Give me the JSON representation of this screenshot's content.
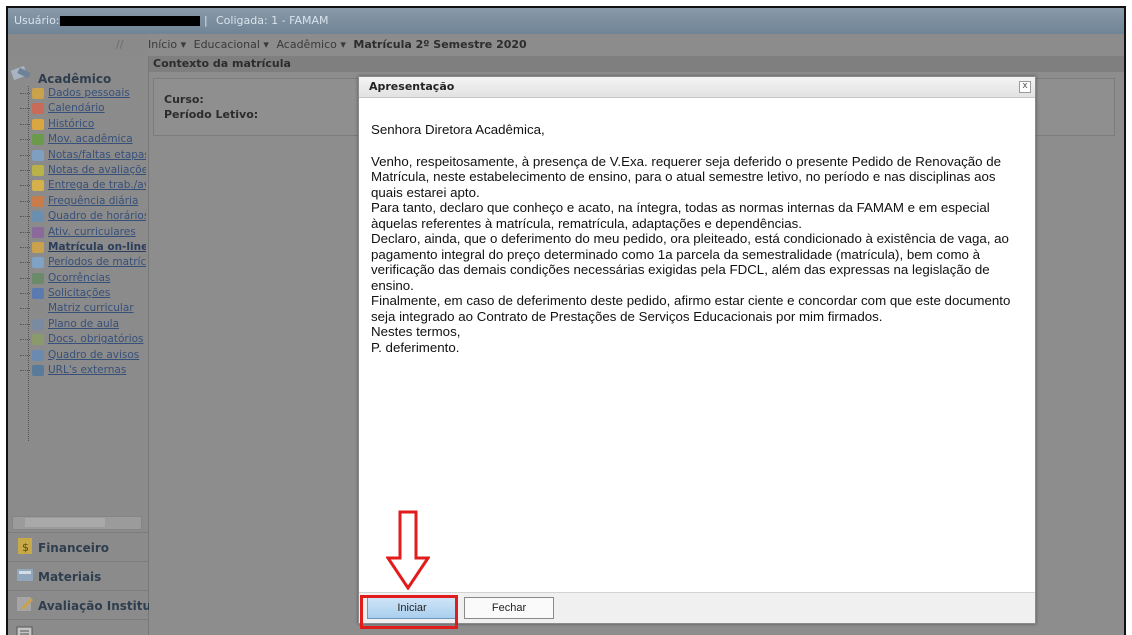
{
  "topbar": {
    "user_label": "Usuário:",
    "separator": "|",
    "coligada": "Coligada: 1 - FAMAM"
  },
  "breadcrumb": {
    "slash": "//",
    "items": [
      "Início ▾",
      "Educacional ▾",
      "Acadêmico ▾"
    ],
    "current": "Matrícula 2º Semestre 2020"
  },
  "sidebar": {
    "header": "Acadêmico",
    "items": [
      {
        "label": "Dados pessoais",
        "icon": "people-icon",
        "color": "#c9a24b"
      },
      {
        "label": "Calendário",
        "icon": "calendar-icon",
        "color": "#c96b5a"
      },
      {
        "label": "Histórico",
        "icon": "document-icon",
        "color": "#d9a640"
      },
      {
        "label": "Mov. acadêmica",
        "icon": "leaf-icon",
        "color": "#6a9a4a"
      },
      {
        "label": "Notas/faltas etapas",
        "icon": "table-icon",
        "color": "#7e9fbf"
      },
      {
        "label": "Notas de avaliações",
        "icon": "pencil-icon",
        "color": "#b9b14a"
      },
      {
        "label": "Entrega de trab./av",
        "icon": "folder-icon",
        "color": "#d6b04a"
      },
      {
        "label": "Frequência diária",
        "icon": "people-icon",
        "color": "#c97c4a"
      },
      {
        "label": "Quadro de horários",
        "icon": "clock-icon",
        "color": "#6b8fb0"
      },
      {
        "label": "Ativ. curriculares",
        "icon": "figure-icon",
        "color": "#8a6a9a"
      },
      {
        "label": "Matrícula on-line",
        "icon": "people-icon",
        "color": "#c9a24b"
      },
      {
        "label": "Períodos de matrícu",
        "icon": "calendar-icon",
        "color": "#7fa2c5"
      },
      {
        "label": "Ocorrências",
        "icon": "megaphone-icon",
        "color": "#6a8a6a"
      },
      {
        "label": "Solicitações",
        "icon": "form-icon",
        "color": "#5a7ab0"
      },
      {
        "label": "Matriz curricular",
        "icon": "pencil-icon",
        "color": "#8a8a8a"
      },
      {
        "label": "Plano de aula",
        "icon": "book-icon",
        "color": "#7a8aa0"
      },
      {
        "label": "Docs. obrigatórios",
        "icon": "docs-icon",
        "color": "#8a9a6a"
      },
      {
        "label": "Quadro de avisos",
        "icon": "board-icon",
        "color": "#6a8ab0"
      },
      {
        "label": "URL's externas",
        "icon": "globe-icon",
        "color": "#5a7a9a"
      }
    ],
    "sections": [
      "Financeiro",
      "Materiais",
      "Avaliação Instituci"
    ]
  },
  "context": {
    "bar_title": "Contexto da matrícula",
    "curso_label": "Curso:",
    "periodo_label": "Período Letivo:"
  },
  "modal": {
    "title": "Apresentação",
    "close": "x",
    "salutation": "Senhora Diretora Acadêmica,",
    "p1": "Venho, respeitosamente, à presença de V.Exa. requerer seja deferido o presente Pedido de Renovação de Matrícula, neste estabelecimento de ensino, para o atual semestre letivo, no período e nas disciplinas aos quais estarei apto.",
    "p2": "Para tanto, declaro que conheço e acato, na íntegra, todas as normas internas da FAMAM e em especial àquelas referentes à matrícula, rematrícula, adaptações e dependências.",
    "p3": "Declaro, ainda, que o deferimento do meu pedido, ora pleiteado, está condicionado à existência de vaga, ao pagamento integral do preço determinado como 1a parcela da semestralidade (matrícula), bem como à verificação das demais condições necessárias exigidas pela FDCL, além das expressas na legislação de ensino.",
    "p4": "Finalmente, em caso de deferimento deste pedido, afirmo estar ciente e concordar com que este documento seja integrado ao Contrato de Prestações de Serviços Educacionais por mim firmados.",
    "p5": "Nestes termos,",
    "p6": "P. deferimento.",
    "btn_start": "Iniciar",
    "btn_close": "Fechar"
  },
  "colors": {
    "highlight": "#e21b1b",
    "primary_button": "#a9cfee"
  }
}
